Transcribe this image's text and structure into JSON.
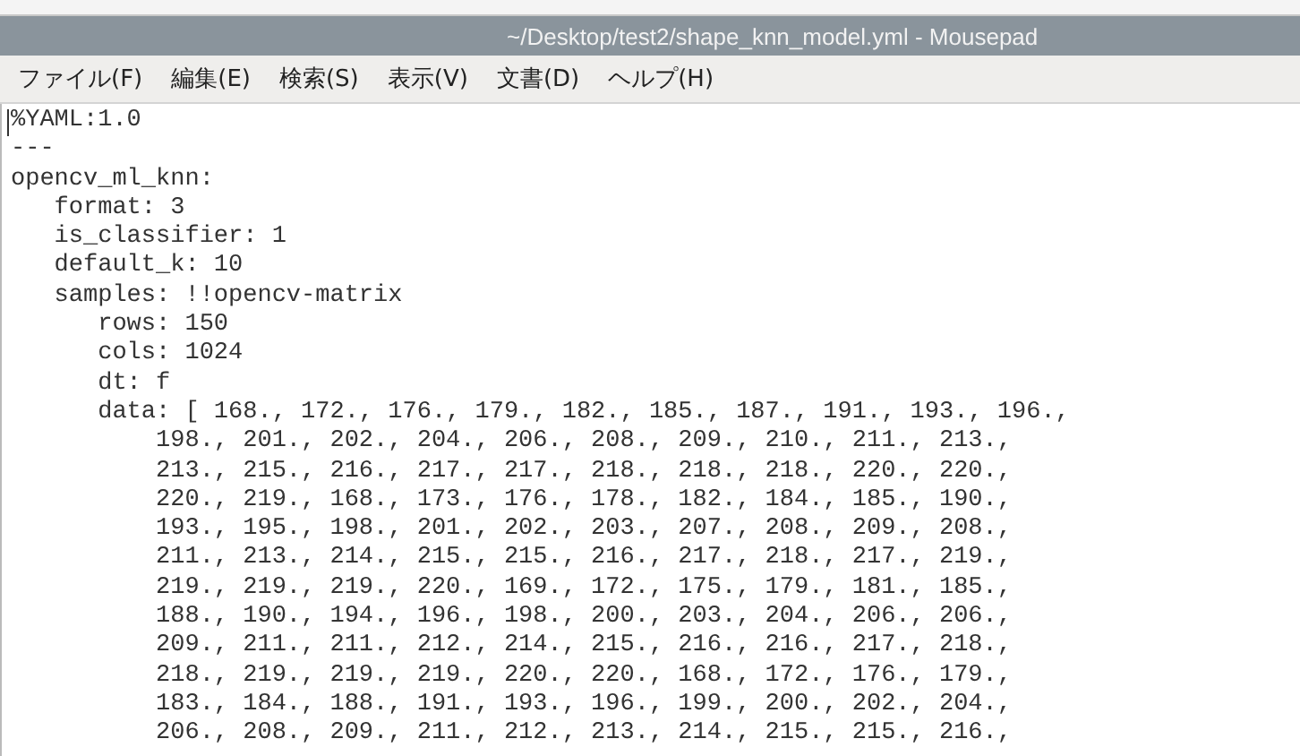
{
  "window": {
    "title": "~/Desktop/test2/shape_knn_model.yml - Mousepad"
  },
  "menu": [
    "ファイル(F)",
    "編集(E)",
    "検索(S)",
    "表示(V)",
    "文書(D)",
    "ヘルプ(H)"
  ],
  "editor": {
    "lines": [
      "%YAML:1.0",
      "---",
      "opencv_ml_knn:",
      "   format: 3",
      "   is_classifier: 1",
      "   default_k: 10",
      "   samples: !!opencv-matrix",
      "      rows: 150",
      "      cols: 1024",
      "      dt: f",
      "      data: [ 168., 172., 176., 179., 182., 185., 187., 191., 193., 196.,",
      "          198., 201., 202., 204., 206., 208., 209., 210., 211., 213.,",
      "          213., 215., 216., 217., 217., 218., 218., 218., 220., 220.,",
      "          220., 219., 168., 173., 176., 178., 182., 184., 185., 190.,",
      "          193., 195., 198., 201., 202., 203., 207., 208., 209., 208.,",
      "          211., 213., 214., 215., 215., 216., 217., 218., 217., 219.,",
      "          219., 219., 219., 220., 169., 172., 175., 179., 181., 185.,",
      "          188., 190., 194., 196., 198., 200., 203., 204., 206., 206.,",
      "          209., 211., 211., 212., 214., 215., 216., 216., 217., 218.,",
      "          218., 219., 219., 219., 220., 220., 168., 172., 176., 179.,",
      "          183., 184., 188., 191., 193., 196., 199., 200., 202., 204.,",
      "          206., 208., 209., 211., 212., 213., 214., 215., 215., 216.,"
    ]
  }
}
